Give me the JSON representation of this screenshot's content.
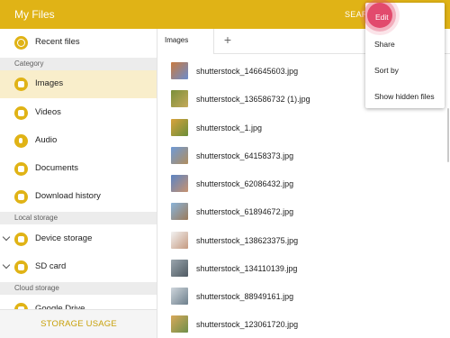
{
  "header": {
    "title": "My Files",
    "search_label": "SEARCH"
  },
  "sidebar": {
    "recent": "Recent files",
    "sections": {
      "category": "Category",
      "local": "Local storage",
      "cloud": "Cloud storage"
    },
    "category_items": [
      "Images",
      "Videos",
      "Audio",
      "Documents",
      "Download history"
    ],
    "local_items": [
      "Device storage",
      "SD card"
    ],
    "cloud_items": [
      "Google Drive"
    ],
    "storage_usage": "STORAGE USAGE"
  },
  "tabs": {
    "active": "Images",
    "add": "+"
  },
  "files": [
    "shutterstock_146645603.jpg",
    "shutterstock_136586732 (1).jpg",
    "shutterstock_1.jpg",
    "shutterstock_64158373.jpg",
    "shutterstock_62086432.jpg",
    "shutterstock_61894672.jpg",
    "shutterstock_138623375.jpg",
    "shutterstock_134110139.jpg",
    "shutterstock_88949161.jpg",
    "shutterstock_123061720.jpg"
  ],
  "menu": {
    "edit": "Edit",
    "share": "Share",
    "sort_by": "Sort by",
    "show_hidden": "Show hidden files"
  },
  "colors": {
    "accent": "#e0b316",
    "active_bg": "#f9eecb",
    "highlight": "#e24a6d"
  }
}
